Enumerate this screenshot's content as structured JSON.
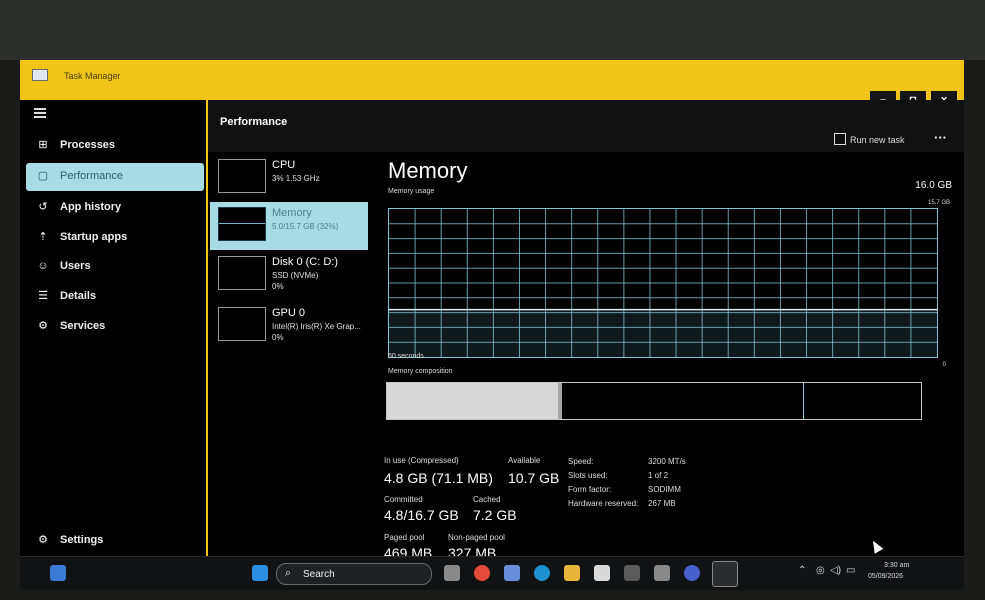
{
  "window": {
    "title": "Task Manager",
    "controls": {
      "minimize": "–",
      "maximize": "◘",
      "close": "x"
    }
  },
  "nav": {
    "items": [
      {
        "label": "Processes",
        "icon": "processes-icon",
        "glyph": "⊞"
      },
      {
        "label": "Performance",
        "icon": "performance-icon",
        "glyph": "▢"
      },
      {
        "label": "App history",
        "icon": "app-history-icon",
        "glyph": "↺"
      },
      {
        "label": "Startup apps",
        "icon": "startup-icon",
        "glyph": "⇡"
      },
      {
        "label": "Users",
        "icon": "users-icon",
        "glyph": "☺"
      },
      {
        "label": "Details",
        "icon": "details-icon",
        "glyph": "☰"
      },
      {
        "label": "Services",
        "icon": "services-icon",
        "glyph": "⚙"
      }
    ],
    "settings": "Settings"
  },
  "header": {
    "title": "Performance",
    "run_new_task": "Run new task",
    "more": "···"
  },
  "devices": [
    {
      "name": "CPU",
      "line1": "3%  1.53 GHz",
      "line2": ""
    },
    {
      "name": "Memory",
      "line1": "5.0/15.7 GB (32%)",
      "line2": ""
    },
    {
      "name": "Disk 0 (C: D:)",
      "line1": "SSD (NVMe)",
      "line2": "0%"
    },
    {
      "name": "GPU 0",
      "line1": "Intel(R) Iris(R) Xe Grap...",
      "line2": "0%"
    }
  ],
  "memory": {
    "title": "Memory",
    "total": "16.0 GB",
    "usage_label": "Memory usage",
    "usage_max": "15.7 GB",
    "time_left": "60 seconds",
    "time_right": "0",
    "composition_label": "Memory composition",
    "usage_fraction": 0.32,
    "composition_in_use_fraction": 0.32,
    "stats": {
      "in_use_label": "In use (Compressed)",
      "in_use_value": "4.8 GB (71.1 MB)",
      "available_label": "Available",
      "available_value": "10.7 GB",
      "committed_label": "Committed",
      "committed_value": "4.8/16.7 GB",
      "cached_label": "Cached",
      "cached_value": "7.2 GB",
      "paged_label": "Paged pool",
      "paged_value": "469 MB",
      "nonpaged_label": "Non-paged pool",
      "nonpaged_value": "327 MB"
    },
    "specs": [
      {
        "k": "Speed:",
        "v": "3200 MT/s"
      },
      {
        "k": "Slots used:",
        "v": "1 of 2"
      },
      {
        "k": "Form factor:",
        "v": "SODIMM"
      },
      {
        "k": "Hardware reserved:",
        "v": "267 MB"
      }
    ]
  },
  "taskbar": {
    "search": "Search",
    "clock_time": "3:30 am",
    "clock_date": "05/09/2026",
    "colors": {
      "accent": "#f0c419",
      "selected": "#a9dbe6",
      "graph": "#7fc3d3"
    }
  }
}
